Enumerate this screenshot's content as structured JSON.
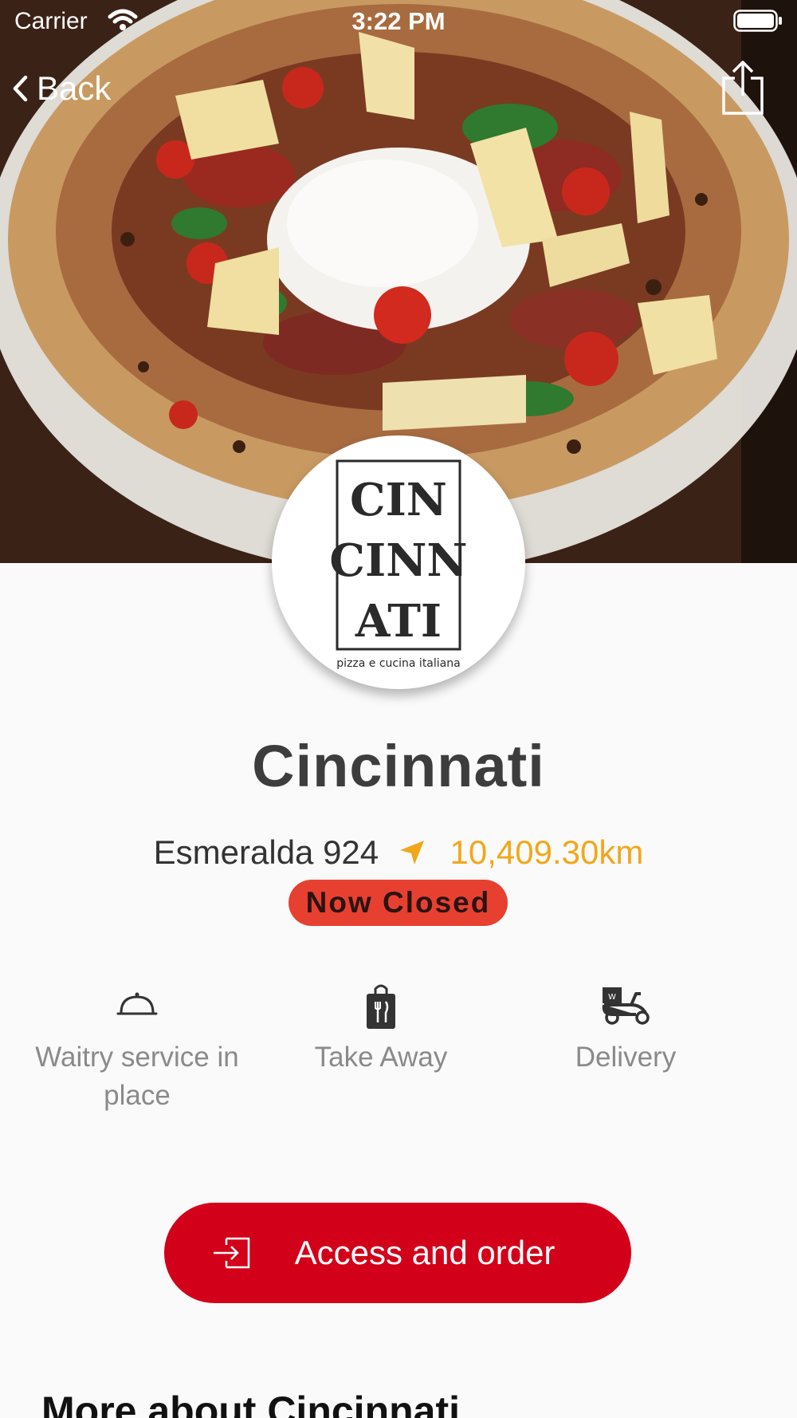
{
  "status_bar": {
    "carrier": "Carrier",
    "time": "3:22 PM"
  },
  "nav": {
    "back_label": "Back"
  },
  "restaurant": {
    "name": "Cincinnati",
    "address": "Esmeralda 924",
    "distance": "10,409.30km",
    "status": "Now Closed",
    "logo_text": [
      "CIN",
      "CINN",
      "ATI",
      "pizza e cucina italiana"
    ]
  },
  "services": [
    {
      "label": "Waitry service in place",
      "icon": "cloche-icon"
    },
    {
      "label": "Take Away",
      "icon": "shopping-bag-icon"
    },
    {
      "label": "Delivery",
      "icon": "delivery-scooter-icon"
    }
  ],
  "cta": {
    "label": "Access and order",
    "icon": "enter-icon"
  },
  "section": {
    "more_title": "More about Cincinnati"
  },
  "colors": {
    "accent_red": "#d3001a",
    "badge_red": "#e74031",
    "distance_orange": "#f2a71a"
  }
}
